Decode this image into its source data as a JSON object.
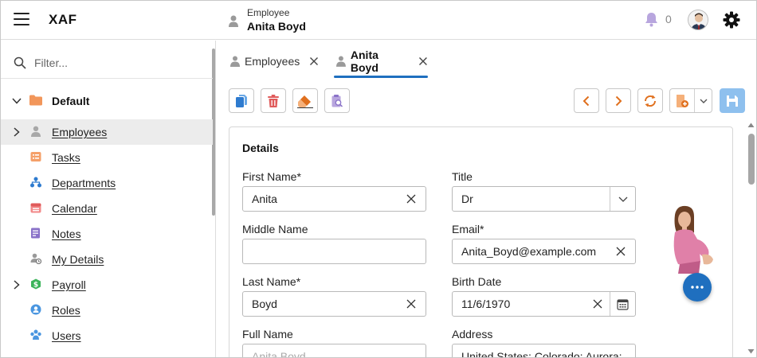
{
  "header": {
    "app_name": "XAF",
    "view_caption": "Employee",
    "view_title": "Anita Boyd",
    "notification_count": "0"
  },
  "sidebar": {
    "filter_placeholder": "Filter...",
    "group_label": "Default",
    "items": [
      {
        "label": "Employees",
        "icon": "person-icon",
        "selected": true,
        "expandable": true
      },
      {
        "label": "Tasks",
        "icon": "tasks-icon"
      },
      {
        "label": "Departments",
        "icon": "org-chart-icon"
      },
      {
        "label": "Calendar",
        "icon": "calendar-icon"
      },
      {
        "label": "Notes",
        "icon": "notes-icon"
      },
      {
        "label": "My Details",
        "icon": "my-details-icon"
      },
      {
        "label": "Payroll",
        "icon": "payroll-icon",
        "expandable": true
      },
      {
        "label": "Roles",
        "icon": "roles-icon"
      },
      {
        "label": "Users",
        "icon": "users-icon"
      }
    ]
  },
  "tabs": [
    {
      "label": "Employees",
      "active": false
    },
    {
      "label": "Anita Boyd",
      "active": true
    }
  ],
  "toolbar": {
    "left": [
      "copy-icon",
      "delete-icon",
      "eraser-icon",
      "clipboard-search-icon"
    ],
    "right": [
      "chevron-left-icon",
      "chevron-right-icon",
      "refresh-icon",
      "new-object-icon",
      "save-icon"
    ]
  },
  "details": {
    "title": "Details",
    "fields": {
      "first_name": {
        "label": "First Name*",
        "value": "Anita"
      },
      "middle_name": {
        "label": "Middle Name",
        "value": ""
      },
      "last_name": {
        "label": "Last Name*",
        "value": "Boyd"
      },
      "full_name": {
        "label": "Full Name",
        "value": "Anita Boyd"
      },
      "title": {
        "label": "Title",
        "value": "Dr"
      },
      "email": {
        "label": "Email*",
        "value": "Anita_Boyd@example.com"
      },
      "birth_date": {
        "label": "Birth Date",
        "value": "11/6/1970"
      },
      "address": {
        "label": "Address",
        "value": "United States; Colorado; Aurora;"
      }
    }
  },
  "colors": {
    "accent": "#1f6fbf",
    "save_disabled": "#8ec0ee",
    "delete": "#e05a5a",
    "navigate": "#e0701e"
  }
}
